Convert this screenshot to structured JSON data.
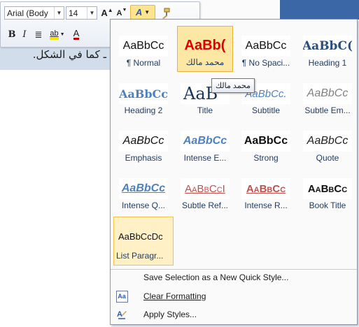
{
  "document": {
    "body_text": "ـ كما في الشكل."
  },
  "mini_toolbar": {
    "font_name": "Arial (Body",
    "font_size": "14",
    "grow_font_label": "A",
    "shrink_font_label": "A",
    "style_label": "A",
    "bold_label": "B",
    "italic_label": "I",
    "center_label": "≣",
    "highlight_label": "ab",
    "font_color_label": "A"
  },
  "gallery": {
    "tooltip": "محمد مالك",
    "styles": [
      {
        "preview": "AaBbCc",
        "name": "¶ Normal"
      },
      {
        "preview": "AaBb(",
        "name": "محمد مالك"
      },
      {
        "preview": "AaBbCc",
        "name": "¶ No Spaci..."
      },
      {
        "preview": "AaBbC(",
        "name": "Heading 1"
      },
      {
        "preview": "AaBbCc",
        "name": "Heading 2"
      },
      {
        "preview": "AaB",
        "name": "Title"
      },
      {
        "preview": "AaBbCc.",
        "name": "Subtitle"
      },
      {
        "preview": "AaBbCc",
        "name": "Subtle Em..."
      },
      {
        "preview": "AaBbCc",
        "name": "Emphasis"
      },
      {
        "preview": "AaBbCc",
        "name": "Intense E..."
      },
      {
        "preview": "AaBbCc",
        "name": "Strong"
      },
      {
        "preview": "AaBbCc",
        "name": "Quote"
      },
      {
        "preview": "AaBbCc",
        "name": "Intense Q..."
      },
      {
        "preview": "AaBbCcI",
        "name": "Subtle Ref..."
      },
      {
        "preview": "AaBbCc",
        "name": "Intense R..."
      },
      {
        "preview": "AaBbCc",
        "name": "Book Title"
      },
      {
        "preview": "AaBbCcDc",
        "name": "List Paragr..."
      }
    ],
    "menu": {
      "save_selection": "Save Selection as a New Quick Style...",
      "clear_formatting": "Clear Formatting",
      "apply_styles": "Apply Styles..."
    }
  }
}
